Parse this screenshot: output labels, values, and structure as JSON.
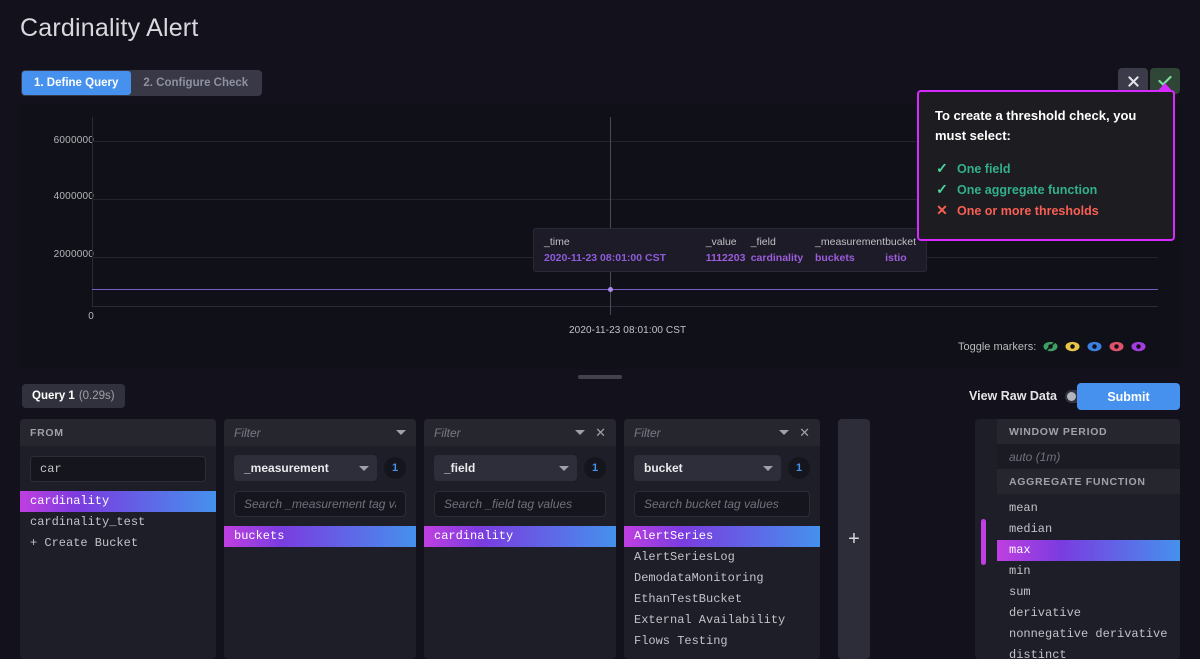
{
  "header": {
    "title": "Cardinality Alert",
    "tabs": [
      {
        "label": "1. Define Query",
        "active": true
      },
      {
        "label": "2. Configure Check",
        "active": false
      }
    ],
    "cancel_icon": "close-icon",
    "confirm_icon": "check-icon"
  },
  "popover": {
    "title": "To create a threshold check, you must select:",
    "requirements": [
      {
        "glyph": "✓",
        "label": "One field",
        "state": "ok"
      },
      {
        "glyph": "✓",
        "label": "One aggregate function",
        "state": "ok"
      },
      {
        "glyph": "✕",
        "label": "One or more thresholds",
        "state": "bad"
      }
    ],
    "border_color": "#d62aff"
  },
  "chart": {
    "y_ticks": [
      "6000000",
      "4000000",
      "2000000",
      "0"
    ],
    "x_tick_label": "2020-11-23 08:01:00 CST",
    "toggle_markers_label": "Toggle markers:",
    "markers": [
      {
        "name": "eye-off-icon",
        "color": "#3f9e62",
        "off": true
      },
      {
        "name": "eye-icon",
        "color": "#e8c547",
        "off": false
      },
      {
        "name": "eye-icon",
        "color": "#3b7fe0",
        "off": false
      },
      {
        "name": "eye-icon",
        "color": "#e0516a",
        "off": false
      },
      {
        "name": "eye-icon",
        "color": "#a43ce0",
        "off": false
      }
    ],
    "tooltip": {
      "columns": [
        {
          "header": "_time",
          "value": "2020-11-23 08:01:00 CST"
        },
        {
          "header": "_value",
          "value": "1112203"
        },
        {
          "header": "_field",
          "value": "cardinality"
        },
        {
          "header": "_measurement",
          "value": "buckets"
        },
        {
          "header": "bucket",
          "value": "istio"
        }
      ]
    }
  },
  "chart_data": {
    "type": "line",
    "title": "",
    "xlabel": "",
    "ylabel": "",
    "ylim": [
      0,
      6500000
    ],
    "yticks": [
      0,
      2000000,
      4000000,
      6000000
    ],
    "grid": true,
    "legend": "none",
    "x": [
      "2020-11-23 08:01:00 CST"
    ],
    "series": [
      {
        "name": "cardinality (buckets, istio)",
        "color": "#7a5cc6",
        "values": [
          1112203
        ],
        "constant": true
      }
    ],
    "annotations": [
      {
        "type": "hover-tooltip",
        "_time": "2020-11-23 08:01:00 CST",
        "_value": 1112203,
        "_field": "cardinality",
        "_measurement": "buckets",
        "bucket": "istio"
      }
    ]
  },
  "querybar": {
    "query_name": "Query 1",
    "query_time": "(0.29s)",
    "raw_data_label": "View Raw Data",
    "raw_data_on": false,
    "submit_label": "Submit"
  },
  "builder": {
    "from": {
      "title": "FROM",
      "search_value": "car",
      "items": [
        {
          "label": "cardinality",
          "selected": true
        },
        {
          "label": "cardinality_test",
          "selected": false
        },
        {
          "label": "+ Create Bucket",
          "selected": false
        }
      ]
    },
    "filters": [
      {
        "head_placeholder": "Filter",
        "closable": false,
        "tag_key": "_measurement",
        "count": "1",
        "search_placeholder": "Search _measurement tag values",
        "items": [
          {
            "label": "buckets",
            "selected": true
          }
        ]
      },
      {
        "head_placeholder": "Filter",
        "closable": true,
        "tag_key": "_field",
        "count": "1",
        "search_placeholder": "Search _field tag values",
        "items": [
          {
            "label": "cardinality",
            "selected": true
          }
        ]
      },
      {
        "head_placeholder": "Filter",
        "closable": true,
        "tag_key": "bucket",
        "count": "1",
        "search_placeholder": "Search bucket tag values",
        "items": [
          {
            "label": "AlertSeries",
            "selected": true
          },
          {
            "label": "AlertSeriesLog",
            "selected": false
          },
          {
            "label": "DemodataMonitoring",
            "selected": false
          },
          {
            "label": "EthanTestBucket",
            "selected": false
          },
          {
            "label": "External Availability",
            "selected": false
          },
          {
            "label": "Flows Testing",
            "selected": false
          }
        ]
      }
    ],
    "add_card_icon": "plus-icon",
    "right": {
      "window_period_title": "WINDOW PERIOD",
      "window_period_placeholder": "auto (1m)",
      "aggregate_title": "AGGREGATE FUNCTION",
      "aggregate_items": [
        {
          "label": "mean",
          "selected": false
        },
        {
          "label": "median",
          "selected": false
        },
        {
          "label": "max",
          "selected": true
        },
        {
          "label": "min",
          "selected": false
        },
        {
          "label": "sum",
          "selected": false
        },
        {
          "label": "derivative",
          "selected": false
        },
        {
          "label": "nonnegative derivative",
          "selected": false
        },
        {
          "label": "distinct",
          "selected": false
        }
      ]
    }
  }
}
